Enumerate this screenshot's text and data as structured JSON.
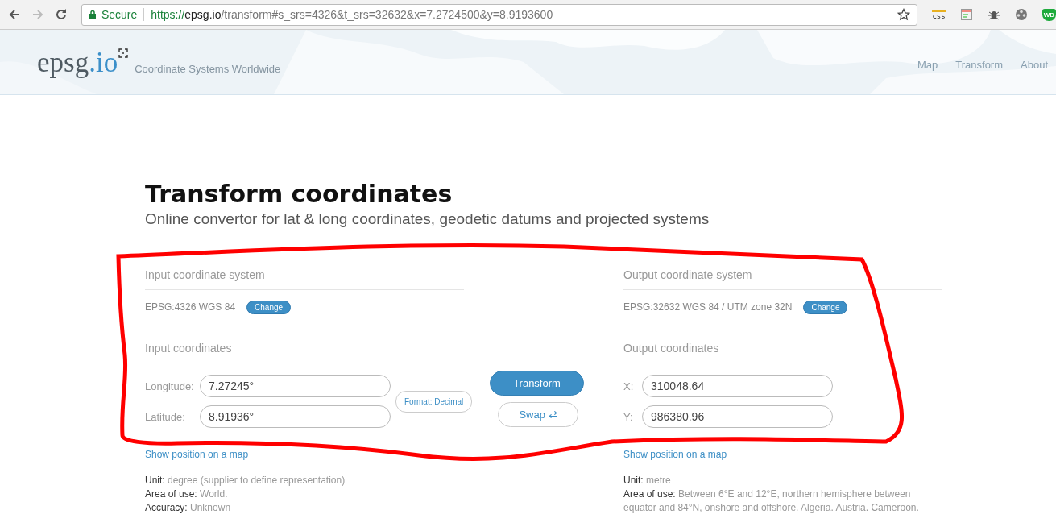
{
  "browser": {
    "secure_label": "Secure",
    "url": {
      "scheme": "https://",
      "host": "epsg.io",
      "path": "/transform#s_srs=4326&t_srs=32632&x=7.2724500&y=8.9193600"
    },
    "extensions": [
      {
        "kind": "css",
        "label": "css"
      },
      {
        "kind": "window"
      },
      {
        "kind": "bug"
      },
      {
        "kind": "reel"
      },
      {
        "kind": "shield",
        "label": "WD"
      }
    ]
  },
  "header": {
    "logo": {
      "name": "epsg",
      "suffix": ".io"
    },
    "tagline": "Coordinate Systems Worldwide",
    "nav": [
      "Map",
      "Transform",
      "About"
    ]
  },
  "page": {
    "title": "Transform coordinates",
    "subtitle": "Online convertor for lat & long coordinates, geodetic datums and projected systems"
  },
  "input": {
    "system_heading": "Input coordinate system",
    "system": "EPSG:4326 WGS 84",
    "change": "Change",
    "coords_heading": "Input coordinates",
    "fields": [
      {
        "label": "Longitude:",
        "value": "7.27245°"
      },
      {
        "label": "Latitude:",
        "value": "8.91936°"
      }
    ],
    "format_button": "Format: Decimal",
    "map_link": "Show position on a map",
    "details": [
      "**Unit:** degree (supplier to define representation)",
      "**Area of use:** World.",
      "**Accuracy:** Unknown"
    ]
  },
  "actions": {
    "transform": "Transform",
    "swap": "Swap ⇄"
  },
  "output": {
    "system_heading": "Output coordinate system",
    "system": "EPSG:32632 WGS 84 / UTM zone 32N",
    "change": "Change",
    "coords_heading": "Output coordinates",
    "fields": [
      {
        "label": "X:",
        "value": "310048.64"
      },
      {
        "label": "Y:",
        "value": "986380.96"
      }
    ],
    "map_link": "Show position on a map",
    "details": [
      "**Unit:** metre",
      "**Area of use:** Between 6°E and 12°E, northern hemisphere between equator and 84°N, onshore and offshore. Algeria. Austria. Cameroon."
    ]
  }
}
